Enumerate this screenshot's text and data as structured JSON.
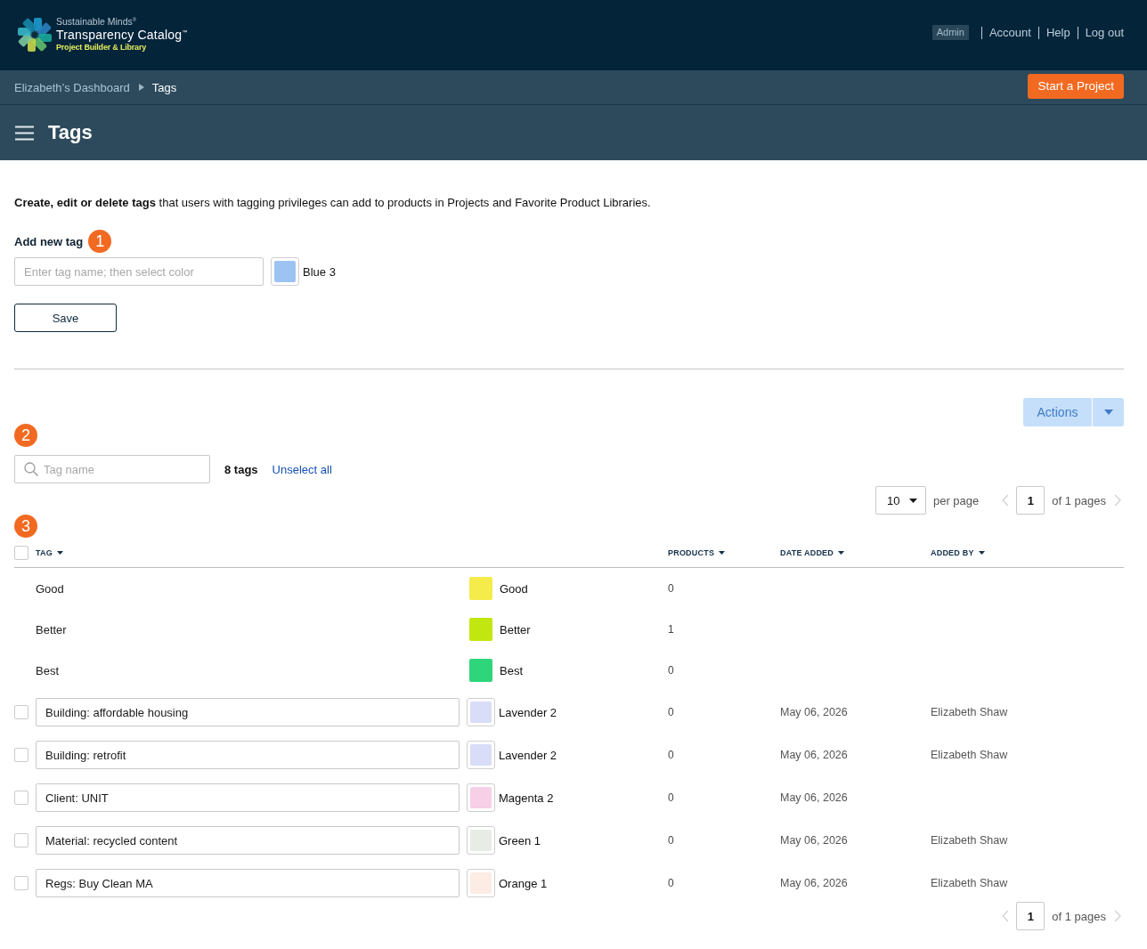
{
  "header": {
    "brand": "Sustainable Minds$^{®}$",
    "product": "Transparency Catalog$^{™}$",
    "subtitle": "Project Builder & Library",
    "role_badge": "Admin",
    "links": [
      "Account",
      "Help",
      "Log out"
    ]
  },
  "breadcrumb": {
    "items": [
      "Elizabeth’s Dashboard",
      "Tags"
    ],
    "button": "Start a Project"
  },
  "title_bar": {
    "title": "Tags"
  },
  "intro": "**Create, edit or delete tags** that users with tagging privileges can add to products in Projects and Favorite Product Libraries.",
  "add_tag": {
    "label": "Add new tag",
    "step": "1",
    "placeholder": "Enter tag name; then select color",
    "color": "#9dc3f2",
    "color_name": "Blue 3",
    "button": "Save"
  },
  "toolbar": {
    "actions": {
      "label": "Actions",
      "disabled": true
    },
    "step": "2",
    "search_placeholder": "Tag name",
    "count": "8 tags",
    "unselect": "Unselect all"
  },
  "pagination_top": {
    "per_page": "10",
    "per_page_label": "per page",
    "prev": {
      "disabled": true
    },
    "page": "1",
    "of_pages": "of 1 pages",
    "next": {
      "disabled": true
    }
  },
  "table": {
    "step": "3",
    "select_all": {
      "checked": false
    },
    "columns": [
      {
        "label": "TAG"
      },
      {
        "label": "PRODUCTS"
      },
      {
        "label": "DATE ADDED"
      },
      {
        "label": "ADDED BY"
      }
    ],
    "rows": [
      {
        "kind": "fixed",
        "name": "Good",
        "color": "#f5eb4b",
        "color_name": "Good",
        "products": "0"
      },
      {
        "kind": "fixed",
        "name": "Better",
        "color": "#c2e60f",
        "color_name": "Better",
        "products": "1"
      },
      {
        "kind": "fixed",
        "name": "Best",
        "color": "#2fd57b",
        "color_name": "Best",
        "products": "0"
      },
      {
        "kind": "editable",
        "checked": false,
        "name": "Building: affordable housing",
        "color": "#d9ddf7",
        "color_name": "Lavender 2",
        "products": "0",
        "date_added": "May 06, 2026",
        "added_by": "Elizabeth Shaw"
      },
      {
        "kind": "editable",
        "checked": false,
        "name": "Building: retrofit",
        "color": "#d9ddf7",
        "color_name": "Lavender 2",
        "products": "0",
        "date_added": "May 06, 2026",
        "added_by": "Elizabeth Shaw"
      },
      {
        "kind": "editable",
        "checked": false,
        "name": "Client: UNIT",
        "color": "#f7cfe7",
        "color_name": "Magenta 2",
        "products": "0",
        "date_added": "May 06, 2026"
      },
      {
        "kind": "editable",
        "checked": false,
        "name": "Material: recycled content",
        "color": "#e7ede5",
        "color_name": "Green 1",
        "products": "0",
        "date_added": "May 06, 2026",
        "added_by": "Elizabeth Shaw"
      },
      {
        "kind": "editable",
        "checked": false,
        "name": "Regs: Buy Clean MA",
        "color": "#fdece4",
        "color_name": "Orange 1",
        "products": "0",
        "date_added": "May 06, 2026",
        "added_by": "Elizabeth Shaw"
      }
    ]
  },
  "pagination_bottom": {
    "prev": {
      "disabled": true
    },
    "page": "1",
    "of_pages": "of 1 pages",
    "next": {
      "disabled": true
    }
  }
}
